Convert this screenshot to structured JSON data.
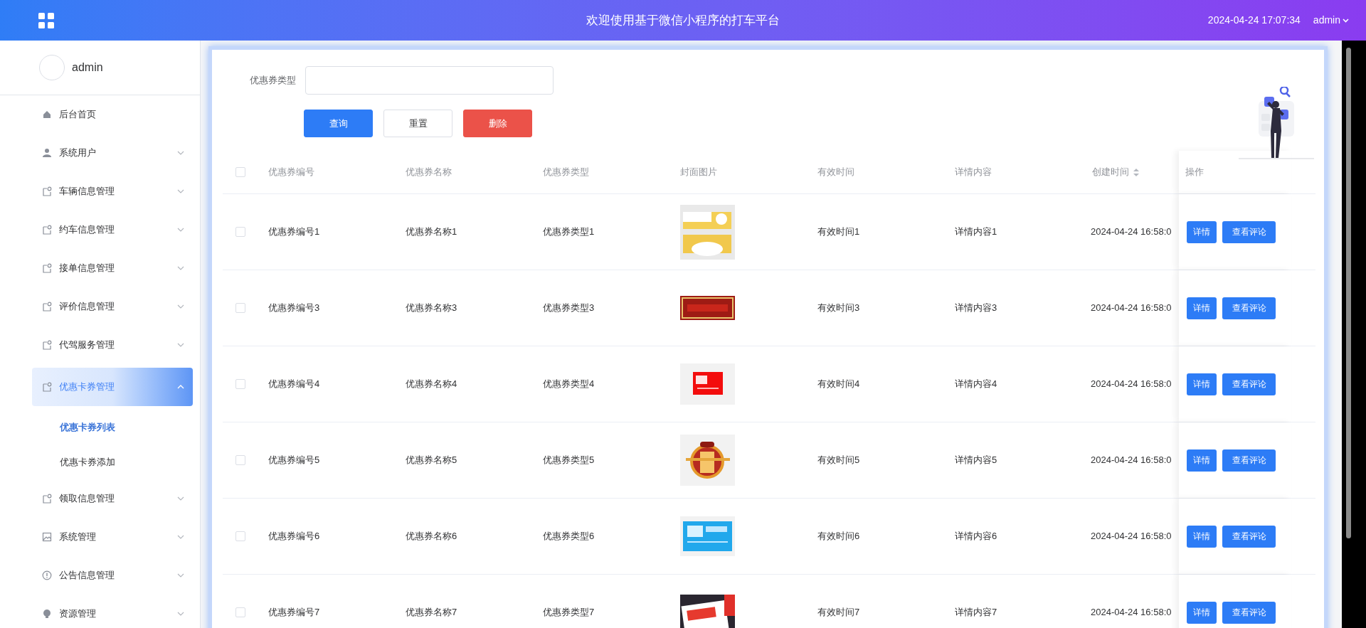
{
  "header": {
    "title": "欢迎使用基于微信小程序的打车平台",
    "datetime": "2024-04-24 17:07:34",
    "user": "admin"
  },
  "sidebar": {
    "user": "admin",
    "items": [
      {
        "label": "后台首页",
        "kind": "link",
        "selected": false
      },
      {
        "label": "系统用户",
        "kind": "menu",
        "expanded": false,
        "selected": false
      },
      {
        "label": "车辆信息管理",
        "kind": "menu",
        "expanded": false,
        "selected": false
      },
      {
        "label": "约车信息管理",
        "kind": "menu",
        "expanded": false,
        "selected": false
      },
      {
        "label": "接单信息管理",
        "kind": "menu",
        "expanded": false,
        "selected": false
      },
      {
        "label": "评价信息管理",
        "kind": "menu",
        "expanded": false,
        "selected": false
      },
      {
        "label": "代驾服务管理",
        "kind": "menu",
        "expanded": false,
        "selected": false
      },
      {
        "label": "优惠卡券管理",
        "kind": "menu",
        "expanded": true,
        "selected": true,
        "children": [
          {
            "label": "优惠卡券列表",
            "selected": true
          },
          {
            "label": "优惠卡券添加",
            "selected": false
          }
        ]
      },
      {
        "label": "领取信息管理",
        "kind": "menu",
        "expanded": false,
        "selected": false
      },
      {
        "label": "系统管理",
        "kind": "menu",
        "expanded": false,
        "selected": false
      },
      {
        "label": "公告信息管理",
        "kind": "menu",
        "expanded": false,
        "selected": false
      },
      {
        "label": "资源管理",
        "kind": "menu",
        "expanded": false,
        "selected": false
      }
    ]
  },
  "search": {
    "label": "优惠券类型"
  },
  "buttons": [
    {
      "label": "查询",
      "kind": "primary"
    },
    {
      "label": "重置",
      "kind": "default"
    },
    {
      "label": "删除",
      "kind": "danger"
    }
  ],
  "table": {
    "select_all": {
      "checked": false
    },
    "columns": [
      {
        "label": "优惠券编号"
      },
      {
        "label": "优惠券名称"
      },
      {
        "label": "优惠券类型"
      },
      {
        "label": "封面图片"
      },
      {
        "label": "有效时间"
      },
      {
        "label": "详情内容"
      },
      {
        "label": "创建时间",
        "sortable": true
      },
      {
        "label": "操作"
      }
    ],
    "rows": [
      {
        "checked": false,
        "cells": [
          "优惠券编号1",
          "优惠券名称1",
          "优惠券类型1"
        ],
        "cover": {
          "kind": "picture"
        },
        "cells2": [
          "有效时间1",
          "详情内容1",
          "2024-04-24 16:58:0"
        ],
        "actions": [
          "详情",
          "查看评论"
        ]
      },
      {
        "checked": false,
        "cells": [
          "优惠券编号3",
          "优惠券名称3",
          "优惠券类型3"
        ],
        "cover": {
          "kind": "picture"
        },
        "cells2": [
          "有效时间3",
          "详情内容3",
          "2024-04-24 16:58:0"
        ],
        "actions": [
          "详情",
          "查看评论"
        ]
      },
      {
        "checked": false,
        "cells": [
          "优惠券编号4",
          "优惠券名称4",
          "优惠券类型4"
        ],
        "cover": {
          "kind": "picture"
        },
        "cells2": [
          "有效时间4",
          "详情内容4",
          "2024-04-24 16:58:0"
        ],
        "actions": [
          "详情",
          "查看评论"
        ]
      },
      {
        "checked": false,
        "cells": [
          "优惠券编号5",
          "优惠券名称5",
          "优惠券类型5"
        ],
        "cover": {
          "kind": "picture"
        },
        "cells2": [
          "有效时间5",
          "详情内容5",
          "2024-04-24 16:58:0"
        ],
        "actions": [
          "详情",
          "查看评论"
        ]
      },
      {
        "checked": false,
        "cells": [
          "优惠券编号6",
          "优惠券名称6",
          "优惠券类型6"
        ],
        "cover": {
          "kind": "picture"
        },
        "cells2": [
          "有效时间6",
          "详情内容6",
          "2024-04-24 16:58:0"
        ],
        "actions": [
          "详情",
          "查看评论"
        ]
      },
      {
        "checked": false,
        "cells": [
          "优惠券编号7",
          "优惠券名称7",
          "优惠券类型7"
        ],
        "cover": {
          "kind": "picture"
        },
        "cells2": [
          "有效时间7",
          "详情内容7",
          "2024-04-24 16:58:0"
        ],
        "actions": [
          "详情",
          "查看评论"
        ]
      }
    ]
  }
}
